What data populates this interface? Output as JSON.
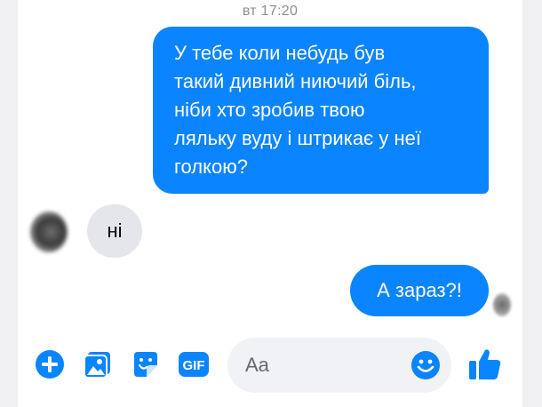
{
  "conversation": {
    "timestamp": "вт 17:20",
    "messages": [
      {
        "direction": "outgoing",
        "lines": [
          "У тебе коли небудь був",
          "такий дивний ниючий біль,",
          "ніби хто зробив твою",
          "ляльку вуду і штрикає у неї",
          "голкою?"
        ]
      },
      {
        "direction": "incoming",
        "text": "ні"
      },
      {
        "direction": "outgoing",
        "text": "А зараз?!"
      }
    ]
  },
  "composer": {
    "placeholder": "Aa",
    "tools": [
      "plus-icon",
      "photo-icon",
      "sticker-icon",
      "gif-icon"
    ],
    "gif_label": "GIF",
    "emoji_icon": "smiley-icon",
    "send_icon": "thumbs-up-icon"
  },
  "colors": {
    "accent": "#0a84ff",
    "incoming_bubble": "#e4e6eb",
    "composer_bg": "#f0f2f5",
    "timestamp": "#8a8d91"
  }
}
